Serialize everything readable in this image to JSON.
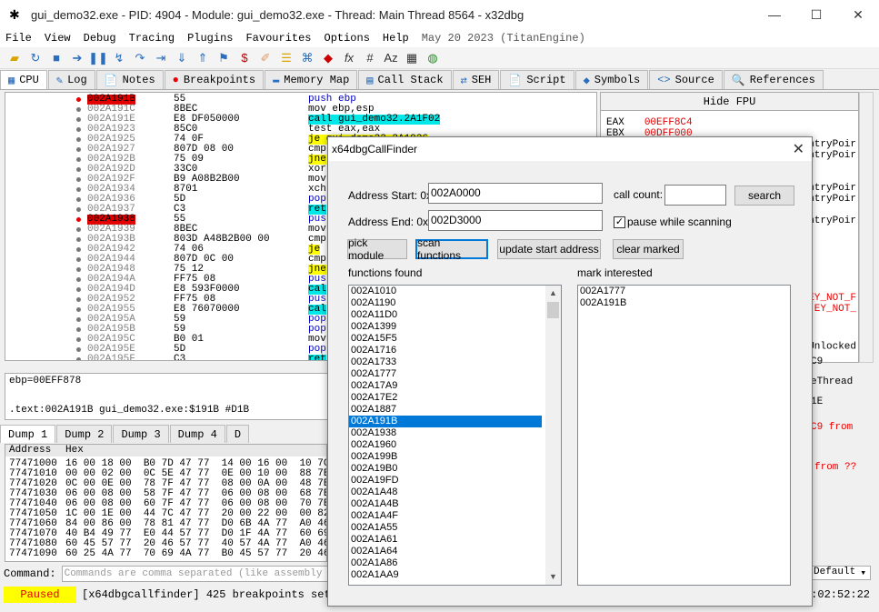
{
  "window": {
    "title": "gui_demo32.exe - PID: 4904 - Module: gui_demo32.exe - Thread: Main Thread 8564 - x32dbg"
  },
  "menu": {
    "items": [
      "File",
      "View",
      "Debug",
      "Tracing",
      "Plugins",
      "Favourites",
      "Options",
      "Help"
    ],
    "date": "May 20 2023 (TitanEngine)"
  },
  "toolbar": {
    "icons": [
      "open-icon",
      "restart-icon",
      "stop-icon",
      "run-icon",
      "pause-icon",
      "step-into-icon",
      "step-over-icon",
      "trace-into-icon",
      "trace-over-icon",
      "execute-till-return-icon",
      "run-to-user-code-icon",
      "script-icon",
      "patch-icon",
      "comment-icon",
      "label-icon",
      "bookmark-icon",
      "function-icon",
      "hash-icon",
      "strings-icon",
      "calculator-icon",
      "globe-icon"
    ]
  },
  "tabs": [
    {
      "label": "CPU",
      "icon": "▦"
    },
    {
      "label": "Log",
      "icon": "✎"
    },
    {
      "label": "Notes",
      "icon": "📄"
    },
    {
      "label": "Breakpoints",
      "icon": "●"
    },
    {
      "label": "Memory Map",
      "icon": "▬"
    },
    {
      "label": "Call Stack",
      "icon": "▤"
    },
    {
      "label": "SEH",
      "icon": "⇄"
    },
    {
      "label": "Script",
      "icon": "📄"
    },
    {
      "label": "Symbols",
      "icon": "◆"
    },
    {
      "label": "Source",
      "icon": "<>"
    },
    {
      "label": "References",
      "icon": "🔍"
    }
  ],
  "cpu": {
    "rows": [
      {
        "addr": "002A191B",
        "bytes": "55",
        "instr": "push ebp",
        "bp": true
      },
      {
        "addr": "002A191C",
        "bytes": "8BEC",
        "instr": "mov ebp,esp"
      },
      {
        "addr": "002A191E",
        "bytes": "E8 DF050000",
        "instr": "call gui_demo32.2A1F02"
      },
      {
        "addr": "002A1923",
        "bytes": "85C0",
        "instr": "test eax,eax"
      },
      {
        "addr": "002A1925",
        "bytes": "74 0F",
        "instr": "je gui_demo32.2A1936"
      },
      {
        "addr": "002A1927",
        "bytes": "807D 08 00",
        "instr": "cmp"
      },
      {
        "addr": "002A192B",
        "bytes": "75 09",
        "instr": "jne"
      },
      {
        "addr": "002A192D",
        "bytes": "33C0",
        "instr": "xor"
      },
      {
        "addr": "002A192F",
        "bytes": "B9 A08B2B00",
        "instr": "mov"
      },
      {
        "addr": "002A1934",
        "bytes": "8701",
        "instr": "xch"
      },
      {
        "addr": "002A1936",
        "bytes": "5D",
        "instr": "pop"
      },
      {
        "addr": "002A1937",
        "bytes": "C3",
        "instr": "ret"
      },
      {
        "addr": "002A1938",
        "bytes": "55",
        "instr": "pus",
        "bp": true
      },
      {
        "addr": "002A1939",
        "bytes": "8BEC",
        "instr": "mov"
      },
      {
        "addr": "002A193B",
        "bytes": "803D A48B2B00 00",
        "instr": "cmp"
      },
      {
        "addr": "002A1942",
        "bytes": "74 06",
        "instr": "je"
      },
      {
        "addr": "002A1944",
        "bytes": "807D 0C 00",
        "instr": "cmp"
      },
      {
        "addr": "002A1948",
        "bytes": "75 12",
        "instr": "jne"
      },
      {
        "addr": "002A194A",
        "bytes": "FF75 08",
        "instr": "pus"
      },
      {
        "addr": "002A194D",
        "bytes": "E8 593F0000",
        "instr": "cal"
      },
      {
        "addr": "002A1952",
        "bytes": "FF75 08",
        "instr": "pus"
      },
      {
        "addr": "002A1955",
        "bytes": "E8 76070000",
        "instr": "cal"
      },
      {
        "addr": "002A195A",
        "bytes": "59",
        "instr": "pop"
      },
      {
        "addr": "002A195B",
        "bytes": "59",
        "instr": "pop"
      },
      {
        "addr": "002A195C",
        "bytes": "B0 01",
        "instr": "mov"
      },
      {
        "addr": "002A195E",
        "bytes": "5D",
        "instr": "pop"
      },
      {
        "addr": "002A195F",
        "bytes": "C3",
        "instr": "ret"
      }
    ]
  },
  "regs": {
    "hide_fpu": "Hide FPU",
    "eax": {
      "name": "EAX",
      "value": "00EFF8C4"
    },
    "ebx": {
      "name": "EBX",
      "value": "00DFF000"
    },
    "side": [
      "ntryPoir",
      "ntryPoir",
      "ntryPoir",
      "ntryPoir",
      "ntryPoir",
      "ntryPoir",
      "EY_NOT_F",
      "EY_NOT_"
    ],
    "unlocked": "Unlocked"
  },
  "info": {
    "line1": "ebp=00EFF878",
    "line2": ".text:002A191B gui_demo32.exe:$191B #D1B"
  },
  "dump": {
    "tabs": [
      "Dump 1",
      "Dump 2",
      "Dump 3",
      "Dump 4",
      "D"
    ],
    "header_addr": "Address",
    "header_hex": "Hex",
    "rows": [
      {
        "a": "77471000",
        "h": "16 00 18 00  B0 7D 47 77  14 00 16 00  10 7C"
      },
      {
        "a": "77471010",
        "h": "00 00 02 00  0C 5E 47 77  0E 00 10 00  88 7E"
      },
      {
        "a": "77471020",
        "h": "0C 00 0E 00  78 7F 47 77  08 00 0A 00  48 7E"
      },
      {
        "a": "77471030",
        "h": "06 00 08 00  58 7F 47 77  06 00 08 00  68 7E"
      },
      {
        "a": "77471040",
        "h": "06 00 08 00  60 7F 47 77  06 00 08 00  70 7E"
      },
      {
        "a": "77471050",
        "h": "1C 00 1E 00  44 7C 47 77  20 00 22 00  00 82"
      },
      {
        "a": "77471060",
        "h": "84 00 86 00  78 81 47 77  D0 6B 4A 77  A0 46"
      },
      {
        "a": "77471070",
        "h": "40 B4 49 77  E0 44 57 77  D0 1F 4A 77  60 69"
      },
      {
        "a": "77471080",
        "h": "60 45 57 77  20 46 57 77  40 57 4A 77  A0 46"
      },
      {
        "a": "77471090",
        "h": "60 25 4A 77  70 69 4A 77  B0 45 57 77  20 46"
      }
    ]
  },
  "cmd": {
    "label": "Command:",
    "placeholder": "Commands are comma separated (like assembly instructions)"
  },
  "status": {
    "paused": "Paused",
    "message": "[x64dbgcallfinder] 425 breakpoints set",
    "time": "0:02:52:22",
    "default": "Default"
  },
  "right_strip": {
    "lines": [
      "C9",
      "eThread",
      "1E",
      "C9 from",
      "from ??"
    ]
  },
  "dialog": {
    "title": "x64dbgCallFinder",
    "address_start_label": "Address Start: 0x",
    "address_start_value": "002A0000",
    "address_end_label": "Address End:  0x",
    "address_end_value": "002D3000",
    "call_count_label": "call count:",
    "call_count_value": "",
    "search": "search",
    "pause_label": "pause while scanning",
    "pause_checked": "✓",
    "buttons": {
      "pick": "pick module",
      "scan": "scan functions",
      "update": "update start address",
      "clear": "clear marked"
    },
    "functions_label": "functions found",
    "marked_label": "mark interested",
    "functions": [
      "002A1010",
      "002A1190",
      "002A11D0",
      "002A1399",
      "002A15F5",
      "002A1716",
      "002A1733",
      "002A1777",
      "002A17A9",
      "002A17E2",
      "002A1887",
      "002A191B",
      "002A1938",
      "002A1960",
      "002A199B",
      "002A19B0",
      "002A19FD",
      "002A1A48",
      "002A1A4B",
      "002A1A4F",
      "002A1A55",
      "002A1A61",
      "002A1A64",
      "002A1A86",
      "002A1AA9"
    ],
    "selected": "002A191B",
    "marked": [
      "002A1777",
      "002A191B"
    ]
  }
}
